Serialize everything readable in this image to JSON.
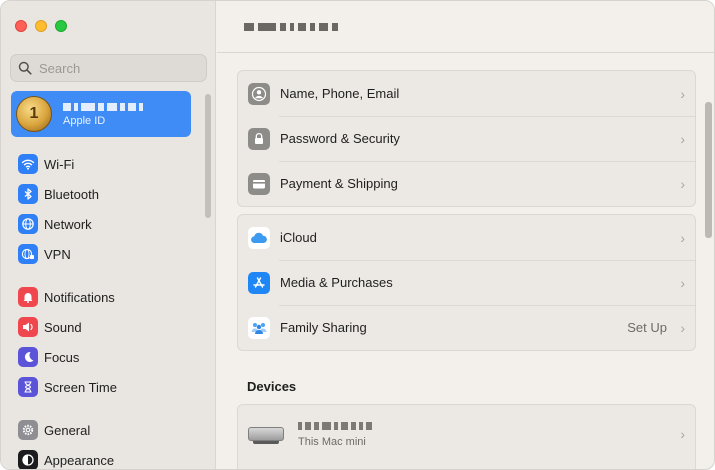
{
  "window": {
    "traffic_lights": [
      "close",
      "minimize",
      "maximize"
    ]
  },
  "search": {
    "placeholder": "Search",
    "value": ""
  },
  "account": {
    "subtitle": "Apple ID",
    "avatar_glyph": "1"
  },
  "sidebar": {
    "items": [
      {
        "label": "Wi-Fi",
        "icon": "wifi-icon",
        "color": "#2f7ff6"
      },
      {
        "label": "Bluetooth",
        "icon": "bluetooth-icon",
        "color": "#2f7ff6"
      },
      {
        "label": "Network",
        "icon": "globe-icon",
        "color": "#2f7ff6"
      },
      {
        "label": "VPN",
        "icon": "vpn-globe-icon",
        "color": "#2f7ff6"
      },
      {
        "label": "Notifications",
        "icon": "bell-icon",
        "color": "#f0464e"
      },
      {
        "label": "Sound",
        "icon": "speaker-icon",
        "color": "#f0464e"
      },
      {
        "label": "Focus",
        "icon": "moon-icon",
        "color": "#5b54d8"
      },
      {
        "label": "Screen Time",
        "icon": "hourglass-icon",
        "color": "#5b54d8"
      },
      {
        "label": "General",
        "icon": "gear-icon",
        "color": "#8e8e93"
      },
      {
        "label": "Appearance",
        "icon": "appearance-icon",
        "color": "#1c1c1e"
      }
    ]
  },
  "main": {
    "groups": [
      {
        "rows": [
          {
            "label": "Name, Phone, Email",
            "icon": "person-icon",
            "value": ""
          },
          {
            "label": "Password & Security",
            "icon": "lock-icon",
            "value": ""
          },
          {
            "label": "Payment & Shipping",
            "icon": "credit-card-icon",
            "value": ""
          }
        ]
      },
      {
        "rows": [
          {
            "label": "iCloud",
            "icon": "icloud-icon",
            "value": ""
          },
          {
            "label": "Media & Purchases",
            "icon": "app-store-icon",
            "value": ""
          },
          {
            "label": "Family Sharing",
            "icon": "family-icon",
            "value": "Set Up"
          }
        ]
      }
    ],
    "devices_title": "Devices",
    "device": {
      "subtitle": "This Mac mini"
    }
  }
}
